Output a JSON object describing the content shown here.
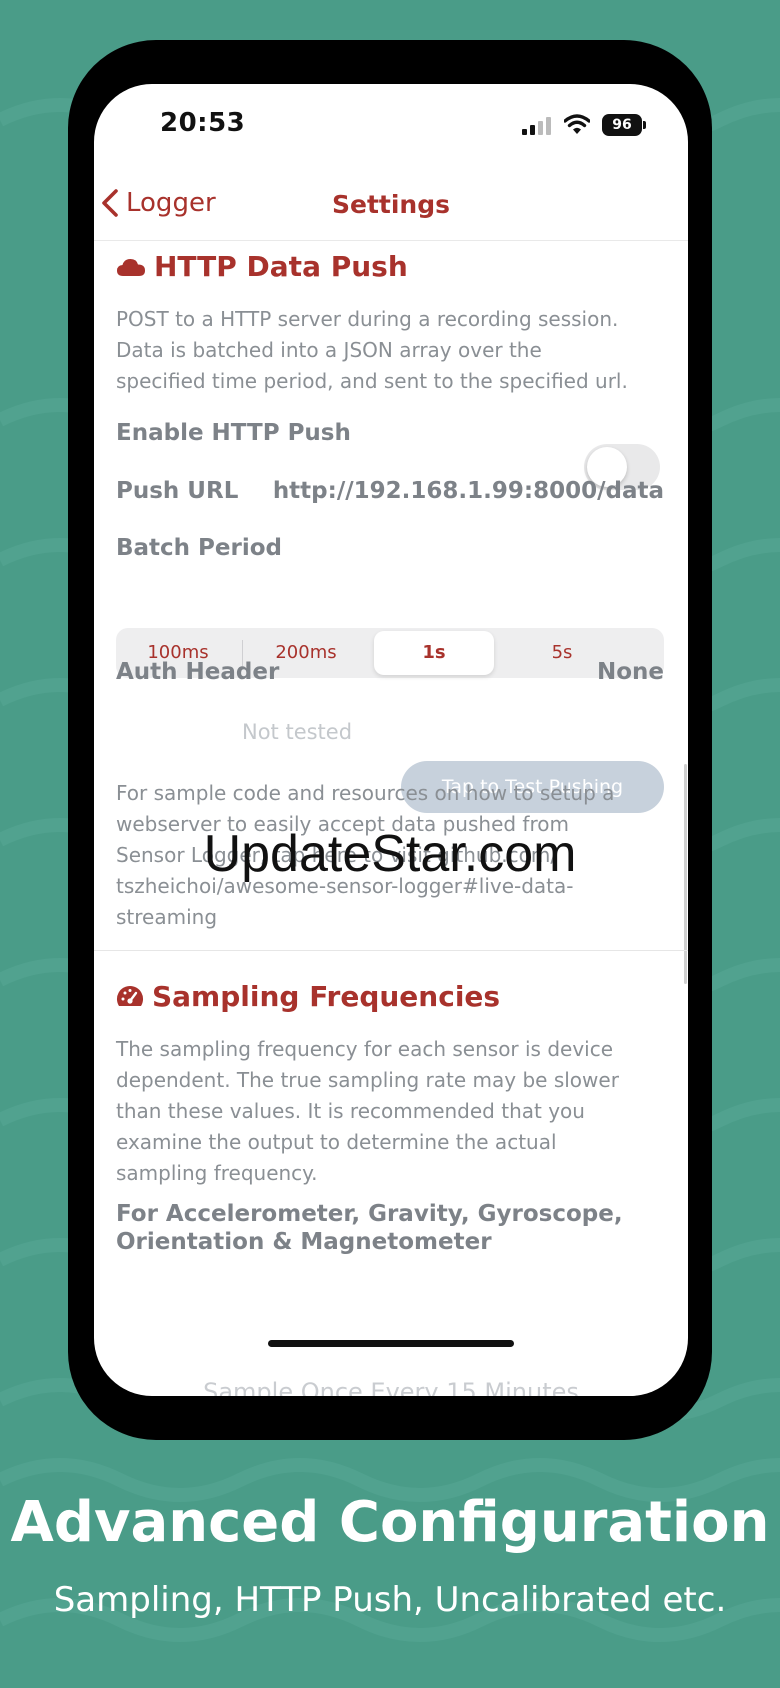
{
  "status_bar": {
    "time": "20:53",
    "battery": "96"
  },
  "nav": {
    "back_label": "Logger",
    "title": "Settings"
  },
  "http_push": {
    "title": "HTTP Data Push",
    "description": "POST to a HTTP server during a recording session. Data is batched into a JSON array over the specified time period, and sent to the specified url.",
    "enable_label": "Enable HTTP Push",
    "enabled": false,
    "url_label": "Push URL",
    "url_value": "http://192.168.1.99:8000/data",
    "batch_label": "Batch Period",
    "batch_options": [
      "100ms",
      "200ms",
      "1s",
      "5s"
    ],
    "batch_selected": "1s",
    "auth_label": "Auth Header",
    "auth_value": "None",
    "test_status": "Not tested",
    "test_button": "Tap to Test Pushing",
    "sample_text": "For sample code and resources on how to setup a webserver to easily accept data pushed from Sensor Logger, tap here to visit github.com/ tszheichoi/awesome-sensor-logger#live-data-streaming"
  },
  "sampling": {
    "title": "Sampling Frequencies",
    "description": "The sampling frequency for each sensor is device dependent. The true sampling rate may be slower than these values. It is recommended that you examine the output to determine the actual sampling frequency.",
    "group_heading": "For Accelerometer, Gravity, Gyroscope, Orientation & Magnetometer",
    "first_option": "Sample Once Every 15 Minutes"
  },
  "watermark": "UpdateStar.com",
  "caption": {
    "title": "Advanced Configuration",
    "subtitle": "Sampling, HTTP Push, Uncalibrated etc."
  },
  "colors": {
    "accent": "#a8322c",
    "background": "#4a9c88",
    "muted_text": "#8a8f94"
  }
}
